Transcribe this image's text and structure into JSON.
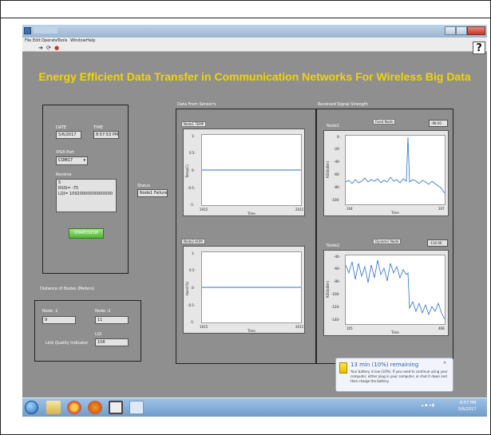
{
  "menu": {
    "items": [
      "File",
      "Edit",
      "Operate",
      "Tools",
      "Window",
      "Help"
    ],
    "help_button": "?"
  },
  "app": {
    "heading": "Energy Efficient Data Transfer in Communication Networks For Wireless Big Data",
    "heading_color": "#f2d400"
  },
  "left_panel": {
    "date_label": "DATE",
    "date_value": "5/6/2017",
    "time_label": "TIME",
    "time_value": "8:57:53 PM",
    "visa_label": "VISA Port",
    "visa_value": "COM17",
    "receive_label": "Receive",
    "receive_lines": [
      "5",
      "RSSI= -75",
      "LQI= 10920000000000000"
    ],
    "start_stop_label": "START/STOP"
  },
  "status": {
    "label": "Status",
    "value": "Node1 Failure"
  },
  "distance_panel": {
    "title": "Distance of Nodes (Meters)",
    "node1_label": "Node :1",
    "node1_value": "9",
    "node2_label": "Node :2",
    "node2_value": "11",
    "lqi_label": "LQI",
    "lqi_value": "108",
    "lqi_caption": "Link Quality Indicator"
  },
  "sensor_panel": {
    "title": "Data From Sensor's",
    "temp_plot": {
      "legend": "Node1 TEMP",
      "ylabel": "Temp(C)",
      "xlabel": "Time",
      "x_ticks": [
        "1915",
        "2015"
      ],
      "y_ticks": [
        "1-",
        "0.5-",
        "0-",
        "-0.5-",
        "-1-"
      ]
    },
    "hum_plot": {
      "legend": "Node2 HUM",
      "ylabel": "Humi(%)",
      "xlabel": "Time",
      "x_ticks": [
        "1915",
        "2015"
      ],
      "y_ticks": [
        "1-",
        "0.5-",
        "0-",
        "-0.5-",
        "-1-"
      ]
    }
  },
  "rssi_panel": {
    "title": "Received Signal Strength",
    "fixed_plot": {
      "node_label": "Node1",
      "name": "Fixed Node",
      "value": "-98.00",
      "ylabel": "RSSI(dBm)",
      "xlabel": "Time",
      "x_ticks": [
        "104",
        "207"
      ],
      "y_ticks": [
        "0-",
        "-20-",
        "-40-",
        "-60-",
        "-80-",
        "-100-"
      ]
    },
    "dynamic_plot": {
      "node_label": "Node2",
      "name": "Dynamic Node",
      "value": "-110.00",
      "ylabel": "RSSI(dBm)",
      "xlabel": "Time",
      "x_ticks": [
        "105",
        "468"
      ],
      "y_ticks": [
        "-40-",
        "-60-",
        "-80-",
        "-100-",
        "-120-",
        "-140-"
      ]
    }
  },
  "notification": {
    "title": "13 min (10%) remaining",
    "body": "Your battery is low (10%). If you need to continue using your computer, either plug in your computer, or shut it down and then charge the battery.",
    "close": "✕"
  },
  "taskbar": {
    "clock_time": "8:57 PM",
    "clock_date": "5/6/2017"
  },
  "colors": {
    "panel_bg": "#8f8f8f",
    "trace": "#2a6fd1",
    "start_button": "#4fb733"
  }
}
